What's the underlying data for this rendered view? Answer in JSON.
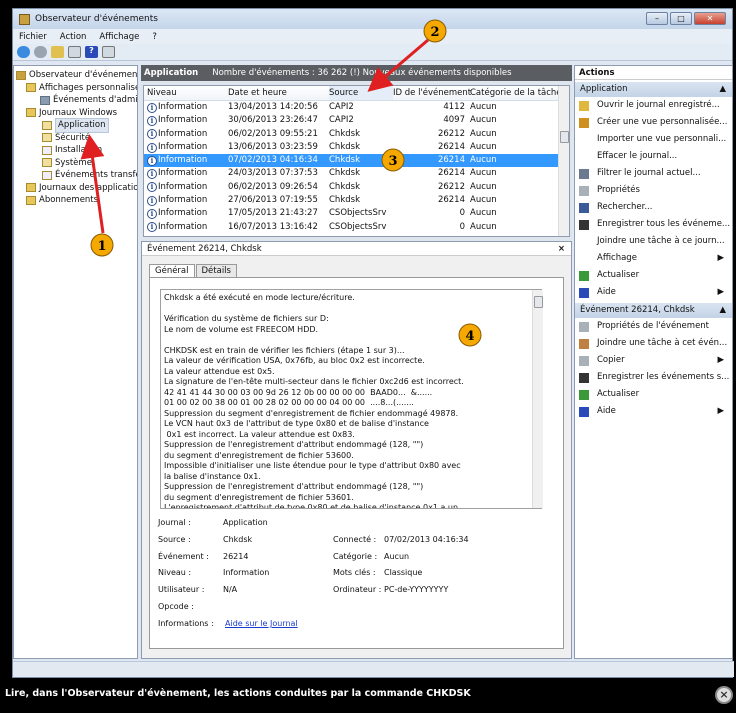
{
  "window": {
    "title": "Observateur d'événements",
    "menu": [
      "Fichier",
      "Action",
      "Affichage",
      "?"
    ]
  },
  "tree": {
    "items": [
      "Observateur d'événements (L",
      "Affichages personnalisés",
      "Événements d'admini",
      "Journaux Windows",
      "Application",
      "Sécurité",
      "Installation",
      "Système",
      "Événements transféré",
      "Journaux des applications",
      "Abonnements"
    ]
  },
  "center": {
    "log_name": "Application",
    "summary": "Nombre d'événements : 36 262 (!) Nouveaux événements disponibles",
    "columns": [
      "Niveau",
      "Date et heure",
      "Source",
      "ID de l'événement",
      "Catégorie de la tâche"
    ],
    "rows": [
      [
        "Information",
        "13/04/2013 14:20:56",
        "CAPI2",
        "4112",
        "Aucun"
      ],
      [
        "Information",
        "30/06/2013 23:26:47",
        "CAPI2",
        "4097",
        "Aucun"
      ],
      [
        "Information",
        "06/02/2013 09:55:21",
        "Chkdsk",
        "26212",
        "Aucun"
      ],
      [
        "Information",
        "13/06/2013 03:23:59",
        "Chkdsk",
        "26214",
        "Aucun"
      ],
      [
        "Information",
        "07/02/2013 04:16:34",
        "Chkdsk",
        "26214",
        "Aucun"
      ],
      [
        "Information",
        "24/03/2013 07:37:53",
        "Chkdsk",
        "26214",
        "Aucun"
      ],
      [
        "Information",
        "06/02/2013 09:26:54",
        "Chkdsk",
        "26212",
        "Aucun"
      ],
      [
        "Information",
        "27/06/2013 07:19:55",
        "Chkdsk",
        "26214",
        "Aucun"
      ],
      [
        "Information",
        "17/05/2013 21:43:27",
        "CSObjectsSrv",
        "0",
        "Aucun"
      ],
      [
        "Information",
        "16/07/2013 13:16:42",
        "CSObjectsSrv",
        "0",
        "Aucun"
      ]
    ],
    "selected_row": 4
  },
  "event": {
    "title": "Événement 26214, Chkdsk",
    "close": "×",
    "tabs": [
      "Général",
      "Détails"
    ],
    "message": "Chkdsk a été exécuté en mode lecture/écriture.\n\nVérification du système de fichiers sur D:\nLe nom de volume est FREECOM HDD.\n\nCHKDSK est en train de vérifier les fichiers (étape 1 sur 3)...\nLa valeur de vérification USA, 0x76fb, au bloc 0x2 est incorrecte.\nLa valeur attendue est 0x5.\nLa signature de l'en-tête multi-secteur dans le fichier 0xc2d6 est incorrect.\n42 41 41 44 30 00 03 00 9d 26 12 0b 00 00 00 00  BAAD0...  &......\n01 00 02 00 38 00 01 00 28 02 00 00 00 04 00 00  ....8...(.......\nSuppression du segment d'enregistrement de fichier endommagé 49878.\nLe VCN haut 0x3 de l'attribut de type 0x80 et de balise d'instance\n 0x1 est incorrect. La valeur attendue est 0x83.\nSuppression de l'enregistrement d'attribut endommagé (128, \"\")\ndu segment d'enregistrement de fichier 53600.\nImpossible d'initialiser une liste étendue pour le type d'attribut 0x80 avec\nla balise d'instance 0x1.\nSuppression de l'enregistrement d'attribut endommagé (128, \"\")\ndu segment d'enregistrement de fichier 53601.\nL'enregistrement d'attribut de type 0x80 et de balise d'instance 0x1 a un",
    "fields": {
      "journal_label": "Journal :",
      "journal": "Application",
      "source_label": "Source :",
      "source": "Chkdsk",
      "connecte_label": "Connecté :",
      "connecte": "07/02/2013 04:16:34",
      "evenement_label": "Événement :",
      "evenement": "26214",
      "categorie_label": "Catégorie :",
      "categorie": "Aucun",
      "niveau_label": "Niveau :",
      "niveau": "Information",
      "mots_label": "Mots clés :",
      "mots": "Classique",
      "utilisateur_label": "Utilisateur :",
      "utilisateur": "N/A",
      "ordinateur_label": "Ordinateur :",
      "ordinateur": "PC-de-YYYYYYYY",
      "opcode_label": "Opcode :",
      "informations_label": "Informations :",
      "informations_link": "Aide sur le Journal"
    }
  },
  "actions": {
    "title": "Actions",
    "group1": {
      "title": "Application",
      "items": [
        {
          "label": "Ouvrir le journal enregistré...",
          "icon": "folder-open-icon",
          "color": "#e0b840"
        },
        {
          "label": "Créer une vue personnalisée...",
          "icon": "filter-icon",
          "color": "#d09020"
        },
        {
          "label": "Importer une vue personnali...",
          "icon": "",
          "color": ""
        },
        {
          "label": "Effacer le journal...",
          "icon": "",
          "color": ""
        },
        {
          "label": "Filtrer le journal actuel...",
          "icon": "filter-icon",
          "color": "#6a7a90"
        },
        {
          "label": "Propriétés",
          "icon": "properties-icon",
          "color": "#aab0b8"
        },
        {
          "label": "Rechercher...",
          "icon": "binoculars-icon",
          "color": "#3a5a9a"
        },
        {
          "label": "Enregistrer tous les événeme...",
          "icon": "save-icon",
          "color": "#333"
        },
        {
          "label": "Joindre une tâche à ce journ...",
          "icon": "",
          "color": ""
        },
        {
          "label": "Affichage",
          "icon": "",
          "color": "",
          "submenu": true
        },
        {
          "label": "Actualiser",
          "icon": "refresh-icon",
          "color": "#3a9a3a"
        },
        {
          "label": "Aide",
          "icon": "help-icon",
          "color": "#2a4aba",
          "submenu": true
        }
      ]
    },
    "group2": {
      "title": "Événement 26214, Chkdsk",
      "items": [
        {
          "label": "Propriétés de l'événement",
          "icon": "properties-icon",
          "color": "#aab0b8"
        },
        {
          "label": "Joindre une tâche à cet évén...",
          "icon": "task-icon",
          "color": "#c08040"
        },
        {
          "label": "Copier",
          "icon": "copy-icon",
          "color": "#aab0b8",
          "submenu": true
        },
        {
          "label": "Enregistrer les événements s...",
          "icon": "save-icon",
          "color": "#333"
        },
        {
          "label": "Actualiser",
          "icon": "refresh-icon",
          "color": "#3a9a3a"
        },
        {
          "label": "Aide",
          "icon": "help-icon",
          "color": "#2a4aba",
          "submenu": true
        }
      ]
    }
  },
  "caption": "Lire, dans l'Observateur d'évènement, les actions conduites par la commande CHKDSK",
  "annotations": [
    "1",
    "2",
    "3",
    "4"
  ],
  "colors": {
    "selection": "#3399ff",
    "annotation": "#f5a800",
    "arrow": "#e02020"
  }
}
